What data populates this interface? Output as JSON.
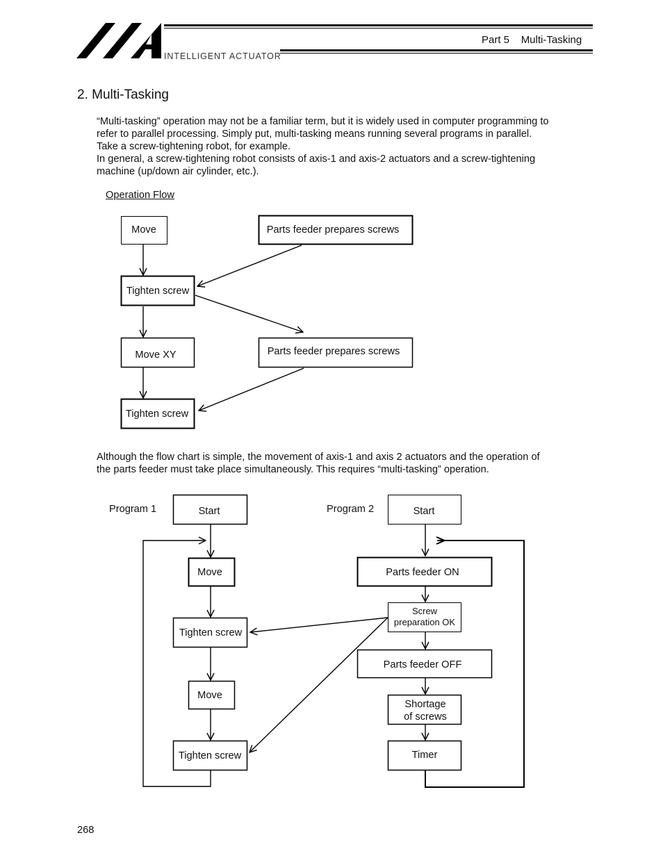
{
  "header": {
    "brand_name": "INTELLIGENT ACTUATOR",
    "part_label": "Part 5    Multi-Tasking"
  },
  "section": {
    "title": "2.  Multi-Tasking"
  },
  "intro_paragraph": {
    "lines": [
      "“Multi-tasking” operation may not be a familiar term, but it is widely used in computer programming to",
      "refer to parallel processing. Simply put, multi-tasking means running several programs in parallel.",
      "Take a screw-tightening robot, for example.",
      "In general, a screw-tightening robot consists of axis-1 and axis-2 actuators and a screw-tightening",
      "machine (up/down air cylinder, etc.)."
    ]
  },
  "operation_flow": {
    "heading": "Operation Flow",
    "left_column": [
      "Move",
      "Tighten screw",
      "Move XY",
      "Tighten screw"
    ],
    "right_column": [
      "Parts feeder prepares screws",
      "Parts feeder prepares screws"
    ]
  },
  "middle_paragraph": {
    "lines": [
      "Although the flow chart is simple, the movement of axis-1 and axis 2 actuators and the operation of",
      "the parts feeder must take place simultaneously. This requires “multi-tasking” operation."
    ]
  },
  "programs": {
    "program1": {
      "label": "Program 1",
      "steps": [
        "Start",
        "Move",
        "Tighten screw",
        "Move",
        "Tighten screw"
      ]
    },
    "program2": {
      "label": "Program 2",
      "steps": [
        "Start",
        "Parts feeder ON",
        "Screw",
        "preparation OK",
        "Parts feeder OFF",
        "Shortage",
        "of screws",
        "Timer"
      ]
    }
  },
  "footer": {
    "page_number": "268"
  }
}
